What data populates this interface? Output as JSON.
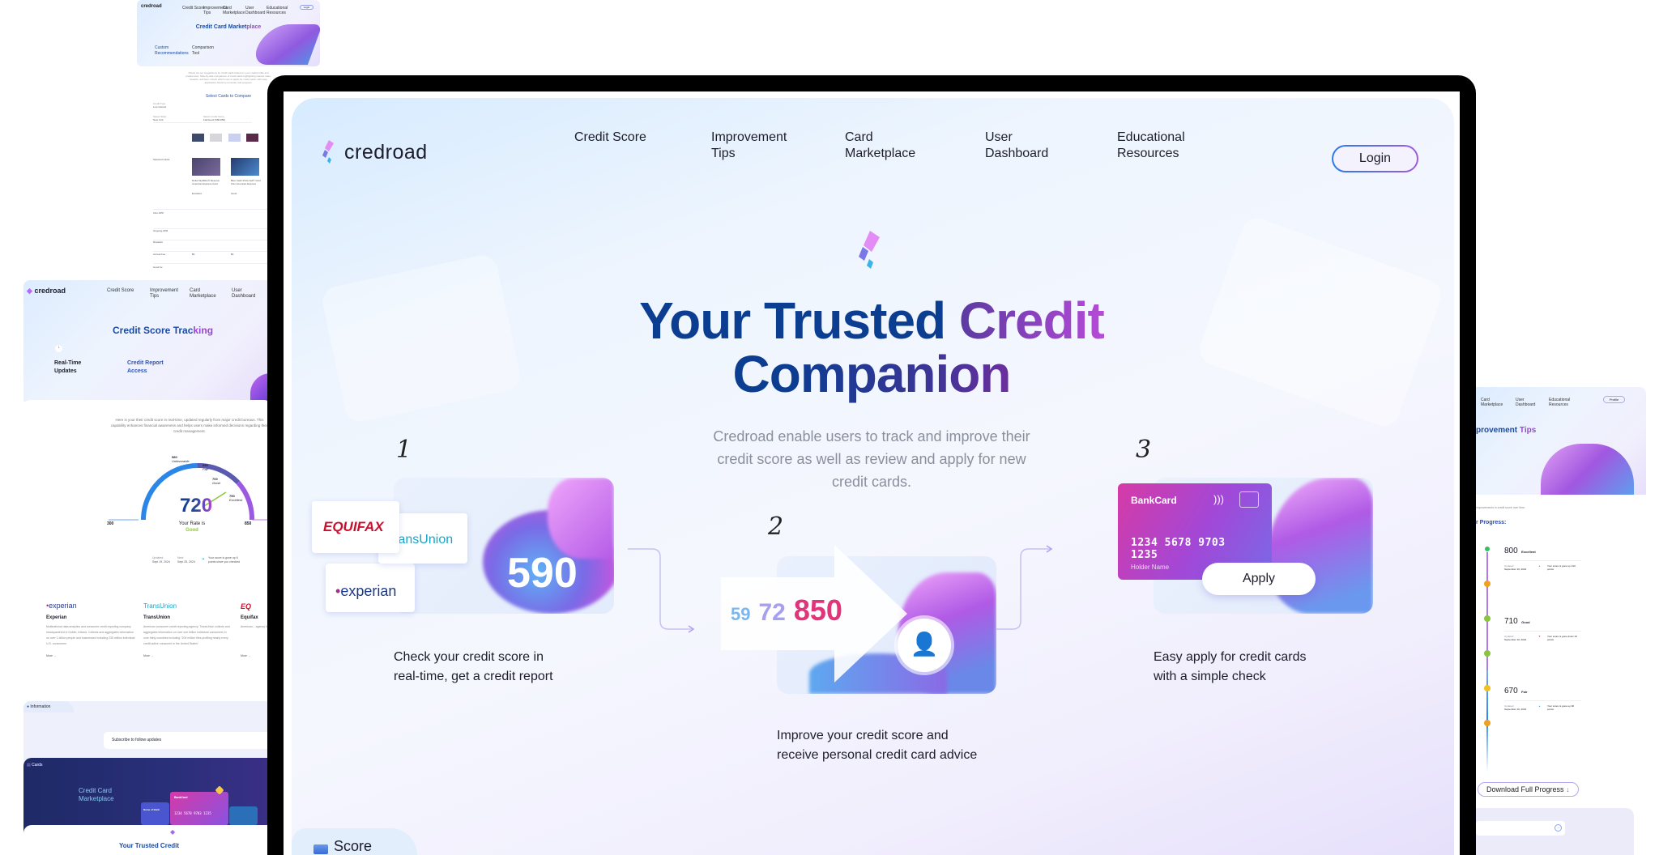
{
  "main": {
    "brand": "credroad",
    "nav": [
      {
        "line1": "Credit Score",
        "line2": ""
      },
      {
        "line1": "Improvement",
        "line2": "Tips"
      },
      {
        "line1": "Card",
        "line2": "Marketplace"
      },
      {
        "line1": "User",
        "line2": "Dashboard"
      },
      {
        "line1": "Educational",
        "line2": "Resources"
      }
    ],
    "login": "Login",
    "hero_title_line1_a": "Your Trusted ",
    "hero_title_line1_b": "Credit",
    "hero_title_line2": "Companion",
    "hero_subtitle": "Credroad enable users to track and improve their credit score as well as review and apply for new credit cards.",
    "steps": [
      {
        "number": "1",
        "caption_line1": "Check your credit score in",
        "caption_line2": "real-time, get a credit report"
      },
      {
        "number": "2",
        "caption_line1": "Improve your credit score and",
        "caption_line2": "receive personal credit card advice"
      },
      {
        "number": "3",
        "caption_line1": "Easy apply for credit cards",
        "caption_line2": "with a simple check"
      }
    ],
    "step1": {
      "bureaus": [
        "EQUIFAX",
        "TransUnion",
        "experian"
      ],
      "score": "590"
    },
    "step2": {
      "scores": [
        "59",
        "72",
        "850"
      ]
    },
    "step3": {
      "card_brand": "BankCard",
      "card_number": "1234  5678  9703  1235",
      "holder": "Holder Name",
      "apply": "Apply"
    },
    "bottom_tab": "Score"
  },
  "marketplace_preview": {
    "brand": "credroad",
    "nav": [
      "Credit Score",
      "Improvement Tips",
      "Card Marketplace",
      "User Dashboard",
      "Educational Resources"
    ],
    "login": "Login",
    "title_a": "Credit Card Market",
    "title_b": "place",
    "features": [
      "Custom Recommendations",
      "Comparison Tool"
    ],
    "intro": "Check out our suggestions for credit cards based on your credit profile and preferences. Side-by-side comparison of credit cards highlighting interest rates, rewards, and fees. Check which ones to apply for credit cards, with easy application check by reminder and progress.",
    "compare_title": "Select Cards to Compare",
    "filters": [
      {
        "label": "Credit Type",
        "value": "Low interest"
      },
      {
        "label": "Select State",
        "value": "New York"
      },
      {
        "label": "Select Credit Score",
        "value": "Fair/Good (580-850)"
      }
    ],
    "rows": [
      "Selected Cards",
      "Intro APR",
      "Ongoing APR",
      "Rewards",
      "Annual Fee",
      "Good for"
    ],
    "cards": [
      {
        "name": "Delta SkyMiles® Reserve American Express Card",
        "score": "Excellent",
        "fee": "$0"
      },
      {
        "name": "Blue Cash Preferred® Card from American Express",
        "score": "Good",
        "fee": "$0"
      }
    ]
  },
  "tracking_preview": {
    "brand": "credroad",
    "nav": [
      "Credit Score",
      "Improvement Tips",
      "Card Marketplace",
      "User Dashboard"
    ],
    "title_a": "Credit Score Trac",
    "title_b": "king",
    "features": [
      "Real-Time Updates",
      "Credit Report Access"
    ],
    "intro": "Here is your their credit score in real-time, updated regularly from major credit bureaus. This capability enhances financial awareness and helps users make informed decisions regarding their credit management.",
    "gauge": {
      "min": "300",
      "max": "850",
      "ticks": [
        "580",
        "650",
        "700",
        "750"
      ],
      "tick_labels": [
        "Unfavorable",
        "Fair",
        "Good",
        "Excellent"
      ],
      "score": "720",
      "score_value": 720,
      "rate_label": "Your Rate is",
      "rate": "Good"
    },
    "updated_label": "Updated:",
    "updated": "Sept 19, 2024",
    "next_label": "Next:",
    "next": "Sept 25, 2024",
    "change_note": "Your score is gone up 6 points since you checked",
    "bureaus": [
      {
        "logo": "experian",
        "name": "Experian",
        "desc": "Multinational data analytics and consumer credit reporting company headquartered in Dublin, Ireland. Collects and aggregates information on over 1 billion people and businesses including 235 million individual U.S. consumers",
        "more": "More"
      },
      {
        "logo": "TransUnion",
        "name": "TransUnion",
        "desc": "American consumer credit reporting agency. TransUnion collects and aggregates information on over one billion individual consumers in over thirty countries including \"200 million files profiling nearly every credit-active consumer in the United States\".",
        "more": "More"
      },
      {
        "logo": "EQ",
        "name": "Equifax",
        "desc": "American... agency h... collects a... million ind... million bu...",
        "more": "More"
      }
    ],
    "info_tab": "Information",
    "subscribe": "Subscribe to follow updates",
    "cards_tab": "Cards",
    "cards_title": "Credit Card Marketplace",
    "card_brand": "BankCard",
    "card_number": "1234  5678  9703  1235",
    "card2_name": "Name of Bank",
    "footer_title": "Your Trusted Credit"
  },
  "progress_preview": {
    "nav": [
      "Card Marketplace",
      "User Dashboard",
      "Educational Resources"
    ],
    "profile": "Profile",
    "title_a": "provement ",
    "title_b": "Tips",
    "intro": "improvements in credit score over time.",
    "progress_title": "r Progress:",
    "entries": [
      {
        "score": "800",
        "rating": "Excellent",
        "updated_label": "Updated:",
        "updated": "September 19, 2024",
        "note": "Your score is gone up 210 points",
        "direction": "up"
      },
      {
        "score": "710",
        "rating": "Good",
        "updated_label": "Updated:",
        "updated": "September 19, 2024",
        "note": "Your score is gone down 10 points",
        "direction": "down"
      },
      {
        "score": "670",
        "rating": "Fair",
        "updated_label": "Updated:",
        "updated": "September 19, 2024",
        "note": "Your score is gone up 90 points",
        "direction": "up"
      }
    ],
    "download": "Download Full Progress"
  },
  "colors": {
    "navy": "#0b3d91",
    "purple": "#a33fd0",
    "pink": "#e0358a",
    "good": "#8bc53f",
    "frame": "#000000"
  }
}
